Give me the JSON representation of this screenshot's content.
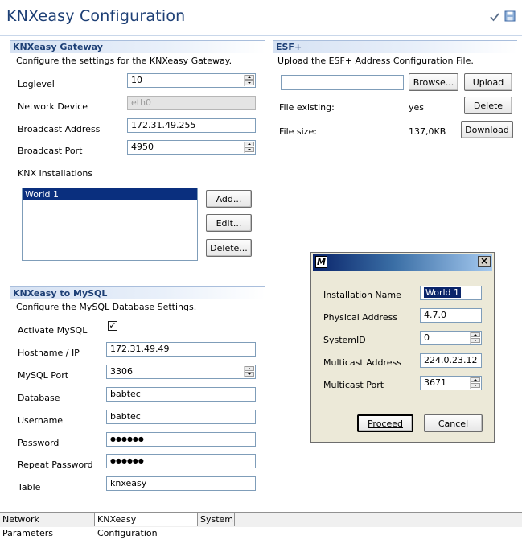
{
  "header": {
    "title": "KNXeasy Configuration",
    "check_icon": "checkmark-icon",
    "save_icon": "save-icon"
  },
  "gateway": {
    "title": "KNXeasy Gateway",
    "desc": "Configure the settings for the KNXeasy Gateway.",
    "loglevel_label": "Loglevel",
    "loglevel_value": "10",
    "device_label": "Network Device",
    "device_value": "eth0",
    "bcast_addr_label": "Broadcast Address",
    "bcast_addr_value": "172.31.49.255",
    "bcast_port_label": "Broadcast Port",
    "bcast_port_value": "4950",
    "installations_label": "KNX Installations",
    "installations": [
      "World 1"
    ],
    "add_label": "Add...",
    "edit_label": "Edit...",
    "delete_label": "Delete..."
  },
  "esf": {
    "title": "ESF+",
    "desc": "Upload the ESF+ Address Configuration File.",
    "file_value": "",
    "browse_label": "Browse...",
    "upload_label": "Upload",
    "existing_label": "File existing:",
    "existing_value": "yes",
    "delete_label": "Delete",
    "size_label": "File size:",
    "size_value": "137,0KB",
    "download_label": "Download"
  },
  "mysql": {
    "title": "KNXeasy to MySQL",
    "desc": "Configure the MySQL Database Settings.",
    "activate_label": "Activate MySQL",
    "activate_mark": "✓",
    "host_label": "Hostname / IP",
    "host_value": "172.31.49.49",
    "port_label": "MySQL Port",
    "port_value": "3306",
    "db_label": "Database",
    "db_value": "babtec",
    "user_label": "Username",
    "user_value": "babtec",
    "pass_label": "Password",
    "pass_value": "●●●●●●",
    "repeat_label": "Repeat Password",
    "repeat_value": "●●●●●●",
    "table_label": "Table",
    "table_value": "knxeasy"
  },
  "dialog": {
    "logo": "M",
    "close": "×",
    "name_label": "Installation Name",
    "name_value": "World 1",
    "phys_label": "Physical Address",
    "phys_value": "4.7.0",
    "sysid_label": "SystemID",
    "sysid_value": "0",
    "mcast_addr_label": "Multicast Address",
    "mcast_addr_value": "224.0.23.12",
    "mcast_port_label": "Multicast Port",
    "mcast_port_value": "3671",
    "proceed_label": "Proceed",
    "cancel_label": "Cancel"
  },
  "tabs": [
    "Network Parameters",
    "KNXeasy Configuration",
    "System"
  ]
}
